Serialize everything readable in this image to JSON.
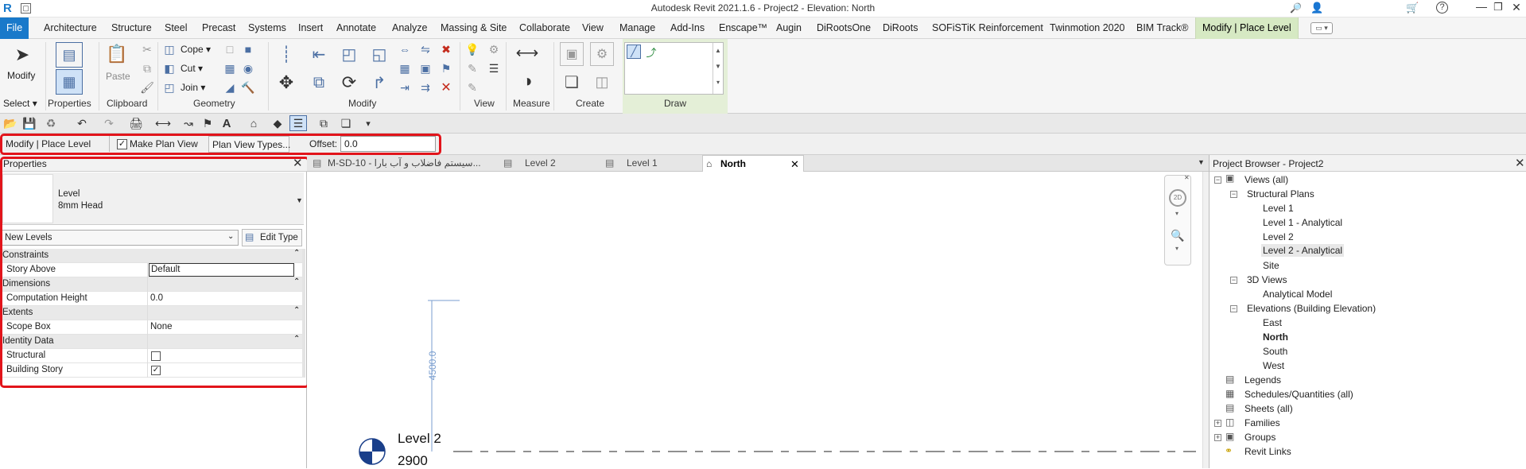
{
  "window": {
    "title": "Autodesk Revit 2021.1.6 - Project2 - Elevation: North",
    "controls": [
      "minimize-icon",
      "restore-icon",
      "close-icon"
    ]
  },
  "menu_tabs": [
    "File",
    "Architecture",
    "Structure",
    "Steel",
    "Precast",
    "Systems",
    "Insert",
    "Annotate",
    "Analyze",
    "Massing & Site",
    "Collaborate",
    "View",
    "Manage",
    "Add-Ins",
    "Enscape™",
    "Augin",
    "DiRootsOne",
    "DiRoots",
    "SOFiSTiK Reinforcement",
    "Twinmotion 2020",
    "BIM Track®",
    "Modify | Place Level"
  ],
  "ribbon": {
    "modify_label": "Modify",
    "paste_label": "Paste",
    "cope_label": "Cope",
    "cut_label": "Cut",
    "join_label": "Join",
    "panels": {
      "select": "Select",
      "properties": "Properties",
      "clipboard": "Clipboard",
      "geometry": "Geometry",
      "modify": "Modify",
      "view": "View",
      "measure": "Measure",
      "create": "Create",
      "draw": "Draw"
    }
  },
  "options_bar": {
    "context": "Modify | Place Level",
    "make_plan_view_label": "Make Plan View",
    "make_plan_view_checked": true,
    "plan_view_types_button": "Plan View Types...",
    "offset_label": "Offset:",
    "offset_value": "0.0"
  },
  "properties": {
    "title": "Properties",
    "type_family": "Level",
    "type_name": "8mm Head",
    "type_selector": "New Levels",
    "edit_type": "Edit Type",
    "groups": [
      {
        "name": "Constraints",
        "rows": [
          {
            "label": "Story Above",
            "value": "Default"
          }
        ]
      },
      {
        "name": "Dimensions",
        "rows": [
          {
            "label": "Computation Height",
            "value": "0.0"
          }
        ]
      },
      {
        "name": "Extents",
        "rows": [
          {
            "label": "Scope Box",
            "value": "None"
          }
        ]
      },
      {
        "name": "Identity Data",
        "rows": [
          {
            "label": "Structural",
            "value": ""
          },
          {
            "label": "Building Story",
            "value": ""
          }
        ]
      }
    ],
    "structural_checked": false,
    "building_story_checked": true
  },
  "view_tabs": [
    {
      "label": "M-SD-10 - سیستم فاضلاب و آب بارا...",
      "active": false
    },
    {
      "label": "Level 2",
      "active": false
    },
    {
      "label": "Level 1",
      "active": false
    },
    {
      "label": "North",
      "active": true
    }
  ],
  "canvas": {
    "level_name": "Level 2",
    "level_elevation": "2900",
    "dimension_text": "4500.0"
  },
  "project_browser": {
    "title": "Project Browser - Project2",
    "views_all": "Views (all)",
    "structural_plans": "Structural Plans",
    "sp_items": [
      "Level 1",
      "Level 1 - Analytical",
      "Level 2",
      "Level 2 - Analytical",
      "Site"
    ],
    "views_3d": "3D Views",
    "v3d_items": [
      "Analytical Model"
    ],
    "elevations": "Elevations (Building Elevation)",
    "elev_items": [
      "East",
      "North",
      "South",
      "West"
    ],
    "other_nodes": [
      "Legends",
      "Schedules/Quantities (all)",
      "Sheets (all)",
      "Families",
      "Groups",
      "Revit Links"
    ]
  },
  "colors": {
    "accent": "#1979ca",
    "context_tab": "#d6e9c3",
    "highlight": "#e2141b"
  }
}
